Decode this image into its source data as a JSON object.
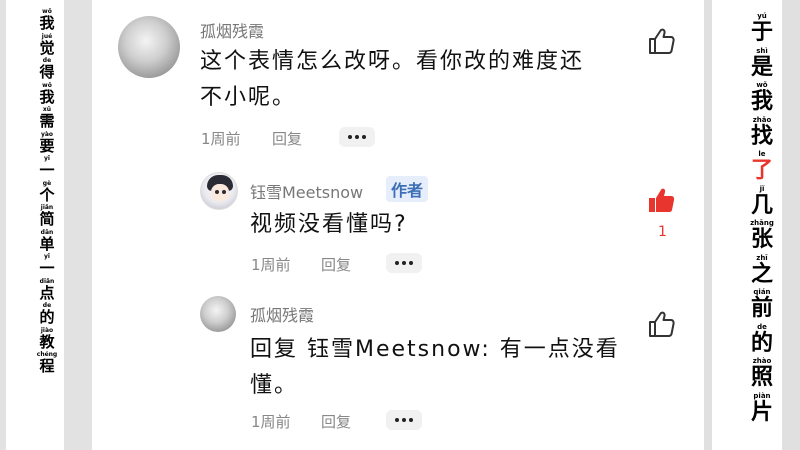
{
  "left_caption": [
    {
      "py": "wǒ",
      "hz": "我"
    },
    {
      "py": "jué",
      "hz": "觉"
    },
    {
      "py": "de",
      "hz": "得"
    },
    {
      "py": "wǒ",
      "hz": "我"
    },
    {
      "py": "xū",
      "hz": "需"
    },
    {
      "py": "yào",
      "hz": "要"
    },
    {
      "py": "yī",
      "hz": "一"
    },
    {
      "py": "gè",
      "hz": "个"
    },
    {
      "py": "jiǎn",
      "hz": "简"
    },
    {
      "py": "dān",
      "hz": "单"
    },
    {
      "py": "yī",
      "hz": "一"
    },
    {
      "py": "diǎn",
      "hz": "点"
    },
    {
      "py": "de",
      "hz": "的"
    },
    {
      "py": "jiào",
      "hz": "教"
    },
    {
      "py": "chéng",
      "hz": "程"
    }
  ],
  "right_caption": [
    {
      "py": "yú",
      "hz": "于"
    },
    {
      "py": "shì",
      "hz": "是"
    },
    {
      "py": "wǒ",
      "hz": "我"
    },
    {
      "py": "zhǎo",
      "hz": "找"
    },
    {
      "py": "le",
      "hz": "了"
    },
    {
      "py": "jǐ",
      "hz": "几"
    },
    {
      "py": "zhāng",
      "hz": "张"
    },
    {
      "py": "zhī",
      "hz": "之"
    },
    {
      "py": "qián",
      "hz": "前"
    },
    {
      "py": "de",
      "hz": "的"
    },
    {
      "py": "zhào",
      "hz": "照"
    },
    {
      "py": "piàn",
      "hz": "片"
    }
  ],
  "comments": {
    "c1": {
      "username": "孤烟残霞",
      "text_line1": "这个表情怎么改呀。看你改的难度还",
      "text_line2": "不小呢。",
      "time": "1周前",
      "reply": "回复"
    },
    "c2": {
      "username": "钰雪Meetsnow",
      "badge": "作者",
      "text": "视频没看懂吗?",
      "time": "1周前",
      "reply": "回复",
      "like_count": "1"
    },
    "c3": {
      "username": "孤烟残霞",
      "text_line1": "回复 钰雪Meetsnow: 有一点没看",
      "text_line2": "懂。",
      "time": "1周前",
      "reply": "回复"
    }
  },
  "icons": {
    "thumb_outline": "thumb-up-outline-icon",
    "thumb_filled": "thumb-up-filled-icon",
    "more": "more-dots-icon"
  },
  "colors": {
    "liked": "#e8352e",
    "badge_text": "#3c6fb6",
    "badge_bg": "#e6eefb",
    "caption_highlight": "#e8352e"
  }
}
